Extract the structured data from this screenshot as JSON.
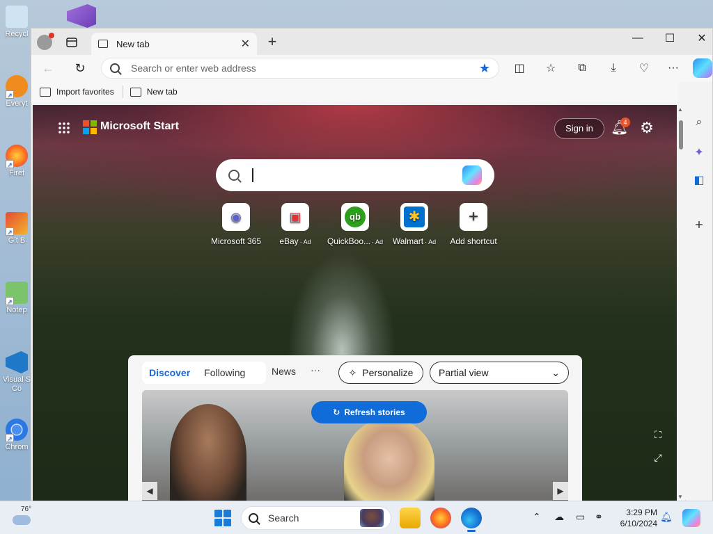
{
  "desktop": {
    "icons": [
      {
        "label": "Recycl"
      },
      {
        "label": "Everyt"
      },
      {
        "label": "Firef"
      },
      {
        "label": "Git B"
      },
      {
        "label": "Notep"
      },
      {
        "label": "Visual S Co"
      },
      {
        "label": "Chrom"
      }
    ]
  },
  "browser": {
    "tab_title": "New tab",
    "address_placeholder": "Search or enter web address",
    "favorites": [
      {
        "label": "Import favorites"
      },
      {
        "label": "New tab"
      }
    ]
  },
  "newtab": {
    "brand": "Microsoft Start",
    "sign_in": "Sign in",
    "notification_count": "4",
    "shortcuts": [
      {
        "label": "Microsoft 365",
        "ad": "",
        "color": "#5b5fc7"
      },
      {
        "label": "eBay",
        "ad": "· Ad",
        "color": "#e53238"
      },
      {
        "label": "QuickBoo...",
        "ad": "· Ad",
        "color": "#2ca01c"
      },
      {
        "label": "Walmart",
        "ad": "· Ad",
        "color": "#0071ce"
      },
      {
        "label": "Add shortcut",
        "ad": "",
        "color": "#333333"
      }
    ],
    "feed": {
      "tabs": [
        "Discover",
        "Following"
      ],
      "news": "News",
      "more": "···",
      "personalize": "Personalize",
      "view_select": "Partial view",
      "refresh": "Refresh stories"
    }
  },
  "taskbar": {
    "temperature": "76°",
    "search_label": "Search",
    "time": "3:29 PM",
    "date": "6/10/2024"
  },
  "colors": {
    "accent": "#1a66d2",
    "refresh_button": "#0f6cd8",
    "notification_badge": "#e5562c"
  }
}
